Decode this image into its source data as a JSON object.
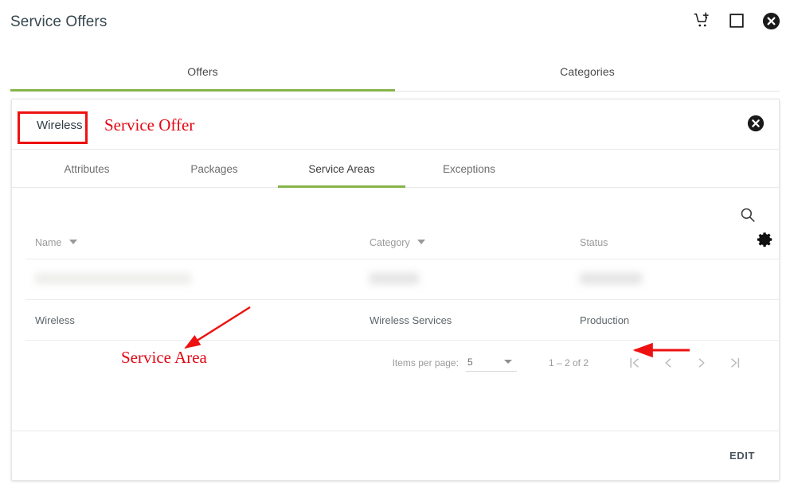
{
  "header": {
    "title": "Service Offers",
    "icons": [
      {
        "name": "add-to-cart-icon"
      },
      {
        "name": "maximize-icon"
      },
      {
        "name": "close-circle-icon"
      }
    ]
  },
  "outer_tabs": [
    {
      "label": "Offers",
      "active": true
    },
    {
      "label": "Categories",
      "active": false
    }
  ],
  "card": {
    "entity_name": "Wireless",
    "close_icon": "close-circle-icon",
    "inner_tabs": [
      {
        "label": "Attributes",
        "active": false
      },
      {
        "label": "Packages",
        "active": false
      },
      {
        "label": "Service Areas",
        "active": true
      },
      {
        "label": "Exceptions",
        "active": false
      }
    ],
    "toolbar": {
      "search_icon": "search-icon",
      "settings_icon": "gear-icon"
    },
    "table": {
      "columns": [
        {
          "label": "Name",
          "sortable": true
        },
        {
          "label": "Category",
          "sortable": true
        },
        {
          "label": "Status",
          "sortable": false
        }
      ],
      "rows": [
        {
          "redacted": true,
          "name": "",
          "category": "",
          "status": ""
        },
        {
          "redacted": false,
          "name": "Wireless",
          "category": "Wireless Services",
          "status": "Production"
        }
      ]
    },
    "paginator": {
      "items_per_page_label": "Items per page:",
      "items_per_page_value": "5",
      "range_label": "1 – 2 of 2",
      "buttons": [
        {
          "name": "first-page-button",
          "glyph": "|‹"
        },
        {
          "name": "previous-page-button",
          "glyph": "‹"
        },
        {
          "name": "next-page-button",
          "glyph": "›"
        },
        {
          "name": "last-page-button",
          "glyph": "›|"
        }
      ]
    },
    "footer": {
      "edit_label": "EDIT"
    }
  },
  "annotations": {
    "service_offer": "Service Offer",
    "service_area": "Service Area",
    "color": "#e30613"
  },
  "colors": {
    "accent_green": "#86b44a",
    "link_green": "#8bc34a",
    "annotation_red": "#e30613",
    "text_primary": "#37474f"
  }
}
